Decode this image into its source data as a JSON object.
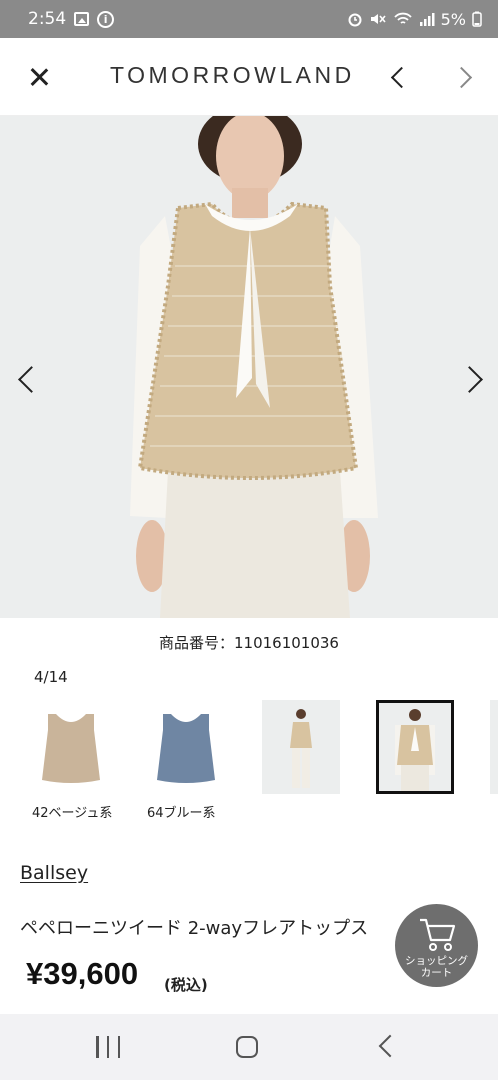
{
  "status_bar": {
    "time": "2:54",
    "battery": "5%"
  },
  "header": {
    "brand": "TOMORROWLAND"
  },
  "product": {
    "code_label": "商品番号：11016101036",
    "image_counter": "4/14",
    "brand": "Ballsey",
    "name": "ペペローニツイード 2-wayフレアトップス",
    "price": "¥39,600",
    "tax_note": "(税込)"
  },
  "colors": [
    {
      "label": "42ベージュ系",
      "swatch": "#c9b49a"
    },
    {
      "label": "64ブルー系",
      "swatch": "#6f86a3"
    }
  ],
  "cart_button": {
    "label_line1": "ショッピング",
    "label_line2": "カート"
  },
  "theme": {
    "status_bar_bg": "#8a8a8a",
    "fab_bg": "#5a5a5a"
  }
}
